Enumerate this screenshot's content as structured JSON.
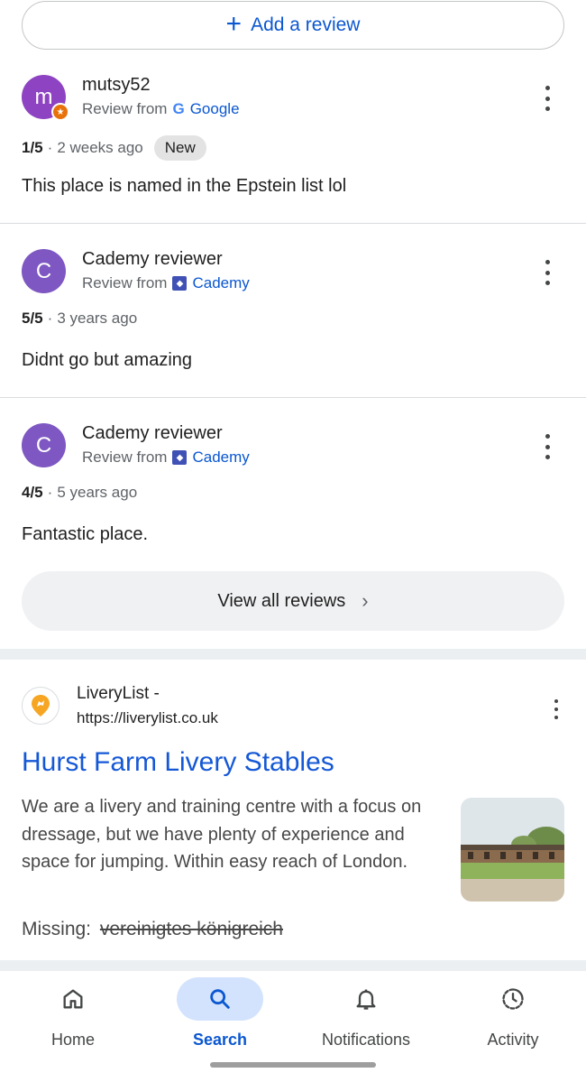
{
  "add_review": {
    "label": "Add a review",
    "icon": "plus-icon"
  },
  "reviews": [
    {
      "avatar_letter": "m",
      "avatar_color": "#8e44c2",
      "has_local_guide_badge": true,
      "name": "mutsy52",
      "source_prefix": "Review from",
      "source_name": "Google",
      "rating": "1/5",
      "time": "2 weeks ago",
      "badge": "New",
      "text": "This place is named in the Epstein list lol"
    },
    {
      "avatar_letter": "C",
      "avatar_color": "#7e57c2",
      "name": "Cademy reviewer",
      "source_prefix": "Review from",
      "source_name": "Cademy",
      "rating": "5/5",
      "time": "3 years ago",
      "text": "Didnt go but amazing"
    },
    {
      "avatar_letter": "C",
      "avatar_color": "#7e57c2",
      "name": "Cademy reviewer",
      "source_prefix": "Review from",
      "source_name": "Cademy",
      "rating": "4/5",
      "time": "5 years ago",
      "text": "Fantastic place."
    }
  ],
  "view_all": {
    "label": "View all reviews"
  },
  "result": {
    "site_name": "LiveryList -",
    "url": "https://liverylist.co.uk",
    "title": "Hurst Farm Livery Stables",
    "snippet": "We are a livery and training centre with a focus on dressage, but we have plenty of experience and space for jumping. Within easy reach of London.",
    "missing_label": "Missing:",
    "missing_terms": "vereinigtes königreich"
  },
  "nav": {
    "items": [
      {
        "label": "Home",
        "icon": "home-icon",
        "active": false
      },
      {
        "label": "Search",
        "icon": "search-icon",
        "active": true
      },
      {
        "label": "Notifications",
        "icon": "bell-icon",
        "active": false
      },
      {
        "label": "Activity",
        "icon": "activity-icon",
        "active": false
      }
    ]
  },
  "colors": {
    "accent": "#0b57d0",
    "link": "#1558d6",
    "active_nav_bg": "#d3e3fd"
  }
}
